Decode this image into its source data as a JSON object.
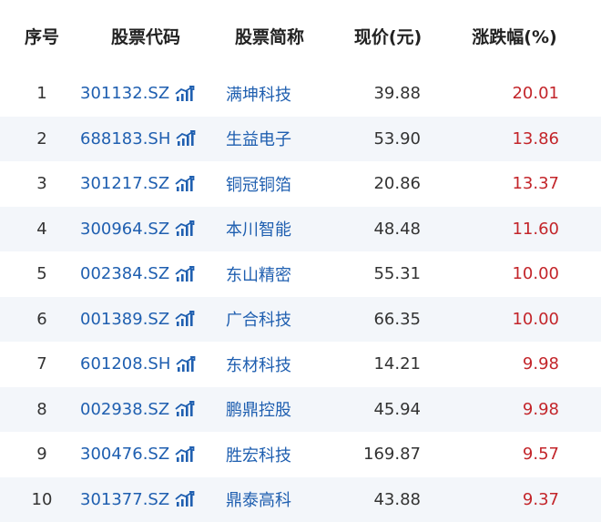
{
  "headers": {
    "index": "序号",
    "code": "股票代码",
    "name": "股票简称",
    "price": "现价(元)",
    "change": "涨跌幅(%)"
  },
  "rows": [
    {
      "index": "1",
      "code": "301132.SZ",
      "name": "满坤科技",
      "price": "39.88",
      "change": "20.01"
    },
    {
      "index": "2",
      "code": "688183.SH",
      "name": "生益电子",
      "price": "53.90",
      "change": "13.86"
    },
    {
      "index": "3",
      "code": "301217.SZ",
      "name": "铜冠铜箔",
      "price": "20.86",
      "change": "13.37"
    },
    {
      "index": "4",
      "code": "300964.SZ",
      "name": "本川智能",
      "price": "48.48",
      "change": "11.60"
    },
    {
      "index": "5",
      "code": "002384.SZ",
      "name": "东山精密",
      "price": "55.31",
      "change": "10.00"
    },
    {
      "index": "6",
      "code": "001389.SZ",
      "name": "广合科技",
      "price": "66.35",
      "change": "10.00"
    },
    {
      "index": "7",
      "code": "601208.SH",
      "name": "东材科技",
      "price": "14.21",
      "change": "9.98"
    },
    {
      "index": "8",
      "code": "002938.SZ",
      "name": "鹏鼎控股",
      "price": "45.94",
      "change": "9.98"
    },
    {
      "index": "9",
      "code": "300476.SZ",
      "name": "胜宏科技",
      "price": "169.87",
      "change": "9.57"
    },
    {
      "index": "10",
      "code": "301377.SZ",
      "name": "鼎泰高科",
      "price": "43.88",
      "change": "9.37"
    }
  ],
  "icon": "stock-chart-icon",
  "colors": {
    "link": "#1f5fb0",
    "up": "#c3252a",
    "stripe": "#f3f6fa"
  }
}
